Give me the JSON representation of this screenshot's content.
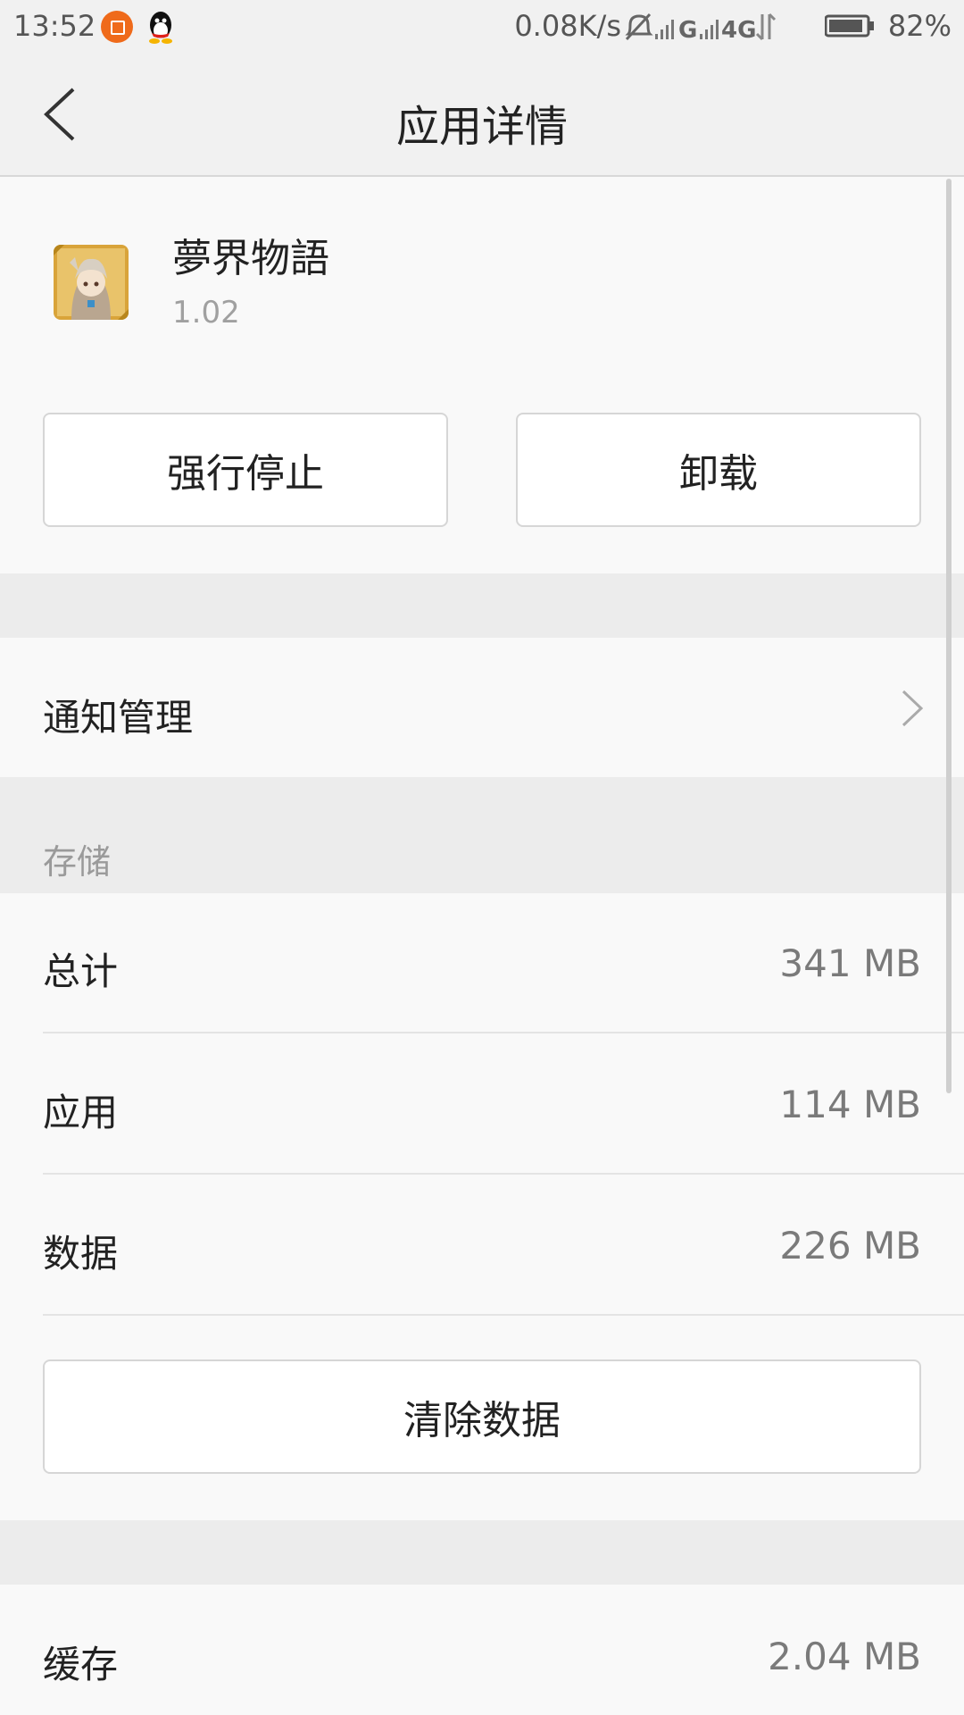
{
  "status_bar": {
    "time": "13:52",
    "net_speed": "0.08K/s",
    "network_g": "G",
    "network_4g": "4G",
    "battery": "82%",
    "icons": [
      "app-notification-icon",
      "qq-icon",
      "mute-bell-icon",
      "signal-icon",
      "signal-icon",
      "data-arrows-icon",
      "battery-icon"
    ]
  },
  "header": {
    "title": "应用详情"
  },
  "app": {
    "name": "夢界物語",
    "version": "1.02"
  },
  "actions": {
    "force_stop": "强行停止",
    "uninstall": "卸载"
  },
  "notification": {
    "label": "通知管理"
  },
  "storage": {
    "section_title": "存储",
    "rows": [
      {
        "label": "总计",
        "value": "341 MB"
      },
      {
        "label": "应用",
        "value": "114 MB"
      },
      {
        "label": "数据",
        "value": "226 MB"
      }
    ],
    "clear_button": "清除数据"
  },
  "cache": {
    "label": "缓存",
    "value": "2.04 MB"
  },
  "colors": {
    "background": "#ececec",
    "panel": "#f9f9f9",
    "accent_orange": "#ef6a1a"
  }
}
